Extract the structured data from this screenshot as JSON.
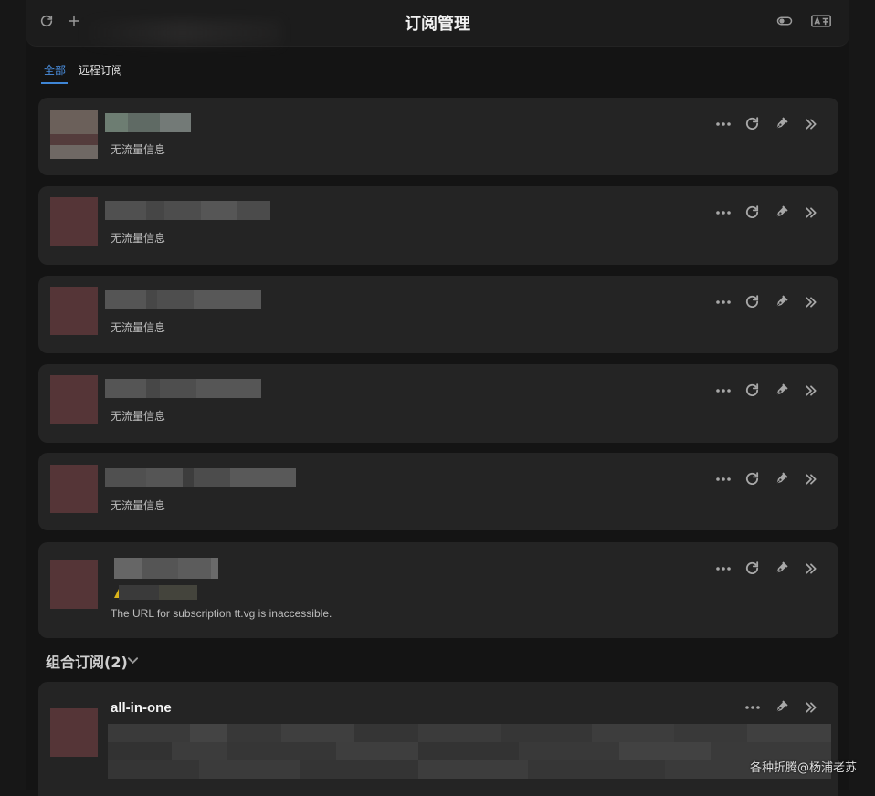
{
  "header": {
    "title": "订阅管理"
  },
  "tabs": [
    {
      "label": "全部",
      "active": true
    },
    {
      "label": "远程订阅",
      "active": false
    }
  ],
  "subscriptions": [
    {
      "status": "无流量信息"
    },
    {
      "status": "无流量信息"
    },
    {
      "status": "无流量信息"
    },
    {
      "status": "无流量信息"
    },
    {
      "status": "无流量信息"
    },
    {
      "status": "",
      "error": "The URL for subscription tt.vg is inaccessible."
    }
  ],
  "group": {
    "header": "组合订阅(2)",
    "item": {
      "name": "all-in-one"
    }
  },
  "watermark": "各种折腾@杨浦老苏",
  "colors": {
    "accent": "#3f86d6",
    "card": "#242424",
    "background": "#141414"
  }
}
